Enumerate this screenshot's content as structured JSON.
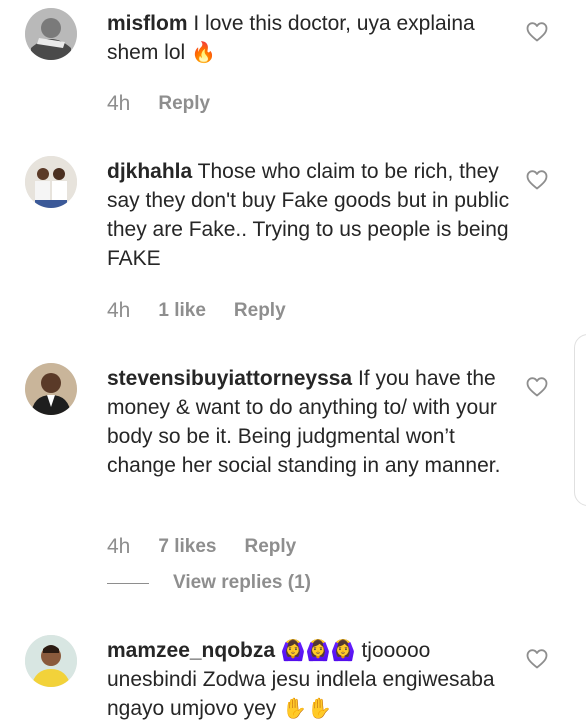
{
  "comments": [
    {
      "username": "misflom",
      "text": "I love this doctor, uya explaina shem lol",
      "emoji": "🔥",
      "time": "4h",
      "likes": "",
      "reply": "Reply"
    },
    {
      "username": "djkhahla",
      "text": "Those who claim to be rich, they say they don't buy Fake goods but in public they are Fake.. Trying to us people is being FAKE",
      "emoji": "",
      "time": "4h",
      "likes": "1 like",
      "reply": "Reply"
    },
    {
      "username": "stevensibuyiattorneyssa",
      "text": "If you have the money & want to do anything to/ with your body so be it. Being judgmental won’t change her social standing in any manner.",
      "emoji": "",
      "time": "4h",
      "likes": "7 likes",
      "reply": "Reply",
      "view_replies": "View replies (1)"
    },
    {
      "username": "mamzee_nqobza",
      "emoji_lead": "🙆‍♀️🙆‍♀️🙆‍♀️",
      "text": "tjooooo unesbindi Zodwa jesu indlela engiwesaba ngayo umjovo yey",
      "emoji": "✋✋"
    }
  ],
  "colors": {
    "text": "#262626",
    "secondary": "#8e8e8e",
    "background": "#ffffff"
  },
  "icons": {
    "like": "heart-outline-icon"
  }
}
